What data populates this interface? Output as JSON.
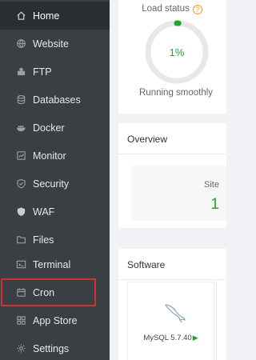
{
  "sidebar": {
    "items": [
      {
        "label": "Home",
        "icon": "home-icon",
        "active": true
      },
      {
        "label": "Website",
        "icon": "globe-icon"
      },
      {
        "label": "FTP",
        "icon": "ftp-icon"
      },
      {
        "label": "Databases",
        "icon": "database-icon"
      },
      {
        "label": "Docker",
        "icon": "docker-icon"
      },
      {
        "label": "Monitor",
        "icon": "monitor-icon"
      },
      {
        "label": "Security",
        "icon": "shield-icon"
      },
      {
        "label": "WAF",
        "icon": "waf-shield-icon"
      },
      {
        "label": "Files",
        "icon": "folder-icon"
      },
      {
        "label": "Terminal",
        "icon": "terminal-icon"
      },
      {
        "label": "Cron",
        "icon": "calendar-icon",
        "highlighted": true
      },
      {
        "label": "App Store",
        "icon": "grid-icon"
      },
      {
        "label": "Settings",
        "icon": "gear-icon"
      }
    ],
    "highlight_color": "#d0312d"
  },
  "load": {
    "title": "Load status",
    "help_glyph": "?",
    "percent": 1,
    "percent_text": "1%",
    "status": "Running smoothly",
    "color": "#20a53a"
  },
  "overview": {
    "title": "Overview",
    "site_label": "Site",
    "site_value": "1"
  },
  "software": {
    "title": "Software",
    "items": [
      {
        "name": "MySQL 5.7.40",
        "icon": "mysql-dolphin-icon",
        "play_glyph": "▶"
      }
    ]
  }
}
